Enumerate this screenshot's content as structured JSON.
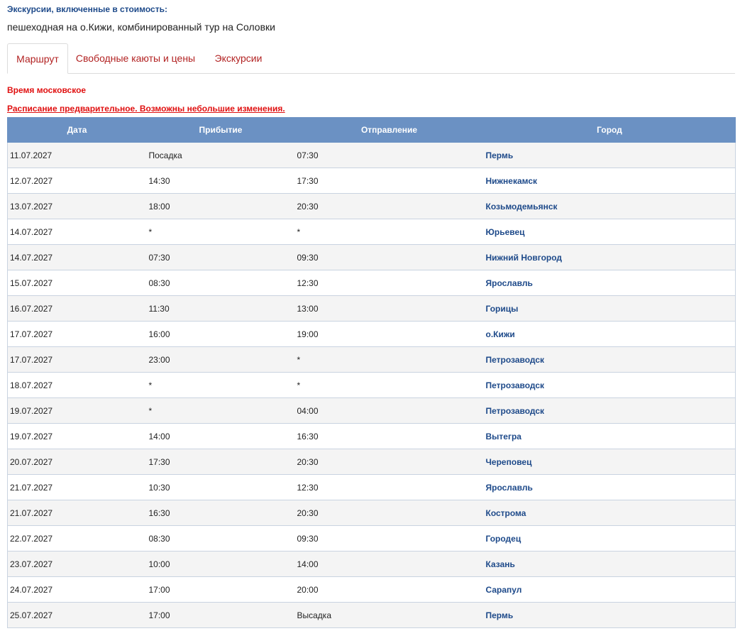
{
  "excursions": {
    "title": "Экскурсии, включенные в стоимость:",
    "text": "пешеходная на о.Кижи, комбинированный тур на Соловки"
  },
  "tabs": [
    {
      "label": "Маршрут",
      "active": true
    },
    {
      "label": "Свободные каюты и цены",
      "active": false
    },
    {
      "label": "Экскурсии",
      "active": false
    }
  ],
  "notes": {
    "time": "Время московское",
    "schedule": "Расписание предварительное. Возможны небольшие изменения."
  },
  "table": {
    "headers": [
      "Дата",
      "Прибытие",
      "Отправление",
      "Город"
    ],
    "rows": [
      [
        "11.07.2027",
        "Посадка",
        "07:30",
        "Пермь"
      ],
      [
        "12.07.2027",
        "14:30",
        "17:30",
        "Нижнекамск"
      ],
      [
        "13.07.2027",
        "18:00",
        "20:30",
        "Козьмодемьянск"
      ],
      [
        "14.07.2027",
        "*",
        "*",
        "Юрьевец"
      ],
      [
        "14.07.2027",
        "07:30",
        "09:30",
        "Нижний Новгород"
      ],
      [
        "15.07.2027",
        "08:30",
        "12:30",
        "Ярославль"
      ],
      [
        "16.07.2027",
        "11:30",
        "13:00",
        "Горицы"
      ],
      [
        "17.07.2027",
        "16:00",
        "19:00",
        "о.Кижи"
      ],
      [
        "17.07.2027",
        "23:00",
        "*",
        "Петрозаводск"
      ],
      [
        "18.07.2027",
        "*",
        "*",
        "Петрозаводск"
      ],
      [
        "19.07.2027",
        "*",
        "04:00",
        "Петрозаводск"
      ],
      [
        "19.07.2027",
        "14:00",
        "16:30",
        "Вытегра"
      ],
      [
        "20.07.2027",
        "17:30",
        "20:30",
        "Череповец"
      ],
      [
        "21.07.2027",
        "10:30",
        "12:30",
        "Ярославль"
      ],
      [
        "21.07.2027",
        "16:30",
        "20:30",
        "Кострома"
      ],
      [
        "22.07.2027",
        "08:30",
        "09:30",
        "Городец"
      ],
      [
        "23.07.2027",
        "10:00",
        "14:00",
        "Казань"
      ],
      [
        "24.07.2027",
        "17:00",
        "20:00",
        "Сарапул"
      ],
      [
        "25.07.2027",
        "17:00",
        "Высадка",
        "Пермь"
      ]
    ]
  }
}
